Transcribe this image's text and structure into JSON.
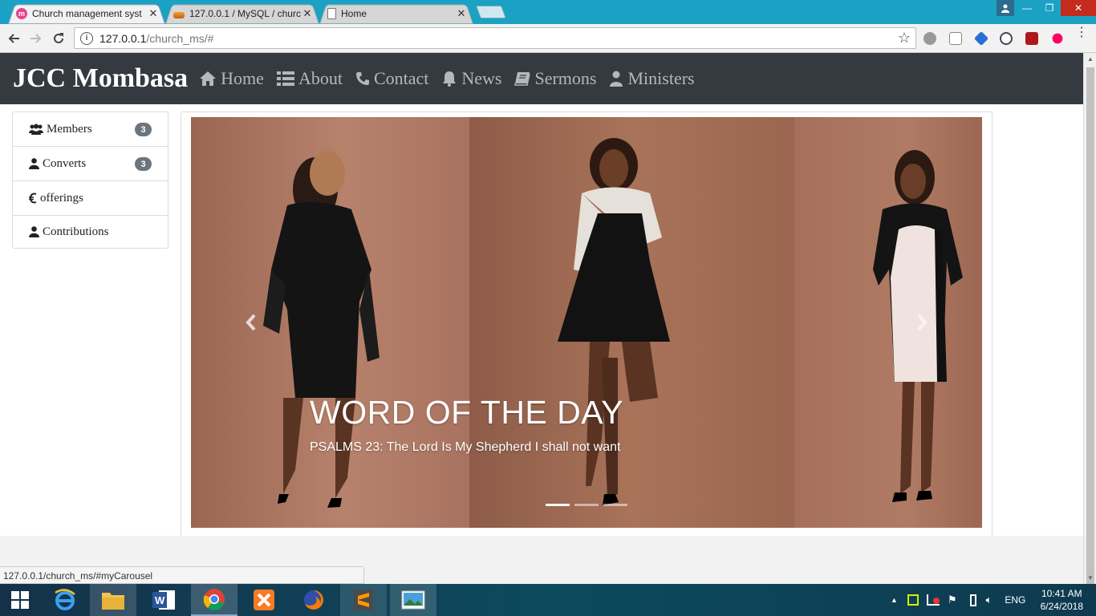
{
  "browser": {
    "tabs": [
      {
        "title": "Church management syst",
        "close": "✕",
        "favicon_color": "#e8428c"
      },
      {
        "title": "127.0.0.1 / MySQL / churc",
        "close": "✕",
        "favicon_color": "#f0a030"
      },
      {
        "title": "Home",
        "close": "✕",
        "favicon_color": "#ffffff"
      }
    ],
    "window_controls": {
      "minimize": "—",
      "restore": "❐",
      "close": "✕"
    },
    "address_host": "127.0.0.1",
    "address_path": "/church_ms/#",
    "status_url": "127.0.0.1/church_ms/#myCarousel"
  },
  "site": {
    "brand": "JCC Mombasa",
    "nav": [
      {
        "label": "Home",
        "icon": "home-icon"
      },
      {
        "label": "About",
        "icon": "list-icon"
      },
      {
        "label": "Contact",
        "icon": "phone-icon"
      },
      {
        "label": "News",
        "icon": "bell-icon"
      },
      {
        "label": "Sermons",
        "icon": "book-icon"
      },
      {
        "label": "Ministers",
        "icon": "user-icon"
      }
    ],
    "sidebar": [
      {
        "label": "Members",
        "badge": "3",
        "icon": "users-icon"
      },
      {
        "label": "Converts",
        "badge": "3",
        "icon": "user-icon"
      },
      {
        "label": "offerings",
        "badge": "",
        "icon": "euro-icon"
      },
      {
        "label": "Contributions",
        "badge": "",
        "icon": "user-icon"
      }
    ],
    "carousel": {
      "title": "WORD OF THE DAY",
      "text": "PSALMS 23: The Lord Is My Shepherd I shall not want",
      "slides": 3,
      "active_slide": 1
    }
  },
  "taskbar": {
    "lang": "ENG",
    "time": "10:41 AM",
    "date": "6/24/2018"
  }
}
